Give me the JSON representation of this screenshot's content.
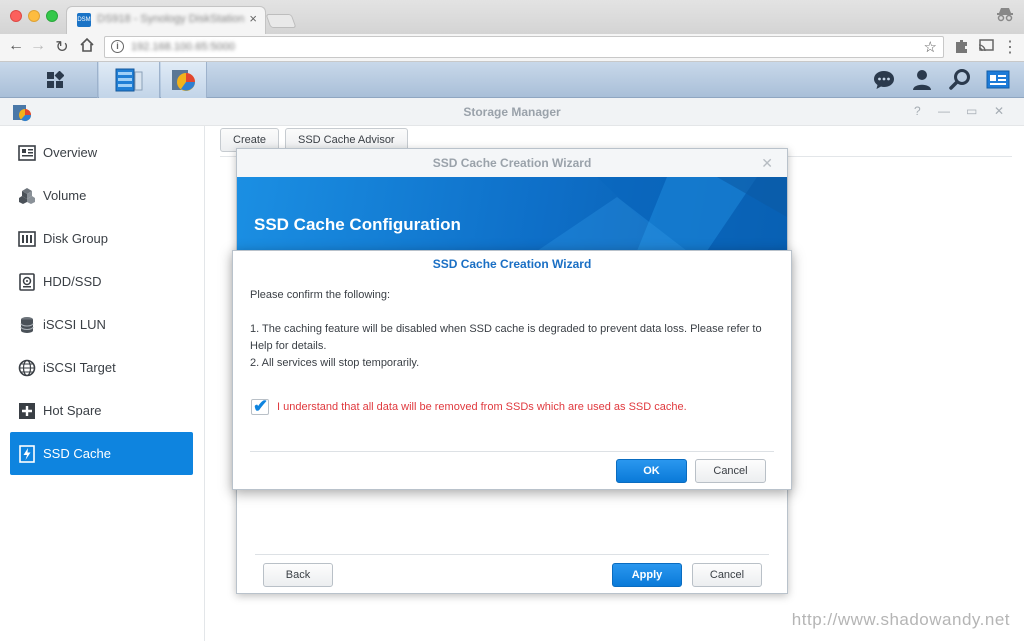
{
  "browser": {
    "tab_title": "DS918 - Synology DiskStation",
    "tab_close": "×",
    "url": "192.168.100.65:5000"
  },
  "window": {
    "title": "Storage Manager",
    "ctrl_help": "?",
    "ctrl_min": "—",
    "ctrl_max": "▭",
    "ctrl_close": "✕"
  },
  "sidebar": {
    "items": [
      {
        "label": "Overview",
        "icon": "overview-icon"
      },
      {
        "label": "Volume",
        "icon": "volume-icon"
      },
      {
        "label": "Disk Group",
        "icon": "disk-group-icon"
      },
      {
        "label": "HDD/SSD",
        "icon": "hdd-icon"
      },
      {
        "label": "iSCSI LUN",
        "icon": "iscsi-lun-icon"
      },
      {
        "label": "iSCSI Target",
        "icon": "iscsi-target-icon"
      },
      {
        "label": "Hot Spare",
        "icon": "hot-spare-icon"
      },
      {
        "label": "SSD Cache",
        "icon": "ssd-cache-icon",
        "selected": true
      }
    ]
  },
  "toolbar": {
    "create_label": "Create",
    "advisor_label": "SSD Cache Advisor"
  },
  "wizard": {
    "title": "SSD Cache Creation Wizard",
    "close": "✕",
    "banner": "SSD Cache Configuration",
    "back_label": "Back",
    "apply_label": "Apply",
    "cancel_label": "Cancel"
  },
  "confirm": {
    "title": "SSD Cache Creation Wizard",
    "intro": "Please confirm the following:",
    "line1": "1. The caching feature will be disabled when SSD cache is degraded to prevent data loss. Please refer to Help for details.",
    "line2": "2. All services will stop temporarily.",
    "checkbox_label": "I understand that all data will be removed from SSDs which are used as SSD cache.",
    "checkbox_checked": true,
    "ok_label": "OK",
    "cancel_label": "Cancel"
  },
  "watermark": "http://www.shadowandy.net",
  "colors": {
    "accent": "#0e84df",
    "warning": "#e0393e",
    "dialog_title": "#1a6fc4"
  }
}
